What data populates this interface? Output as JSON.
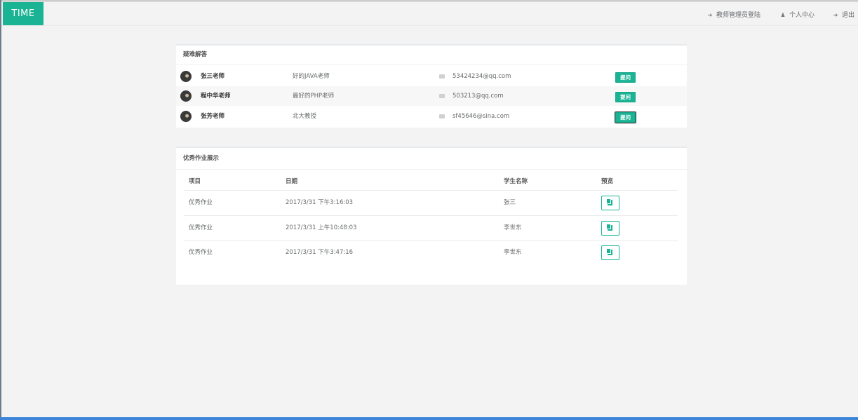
{
  "brand": "TIME",
  "nav": {
    "teacher_admin_login": "教师管理员登陆",
    "personal_center": "个人中心",
    "logout": "退出"
  },
  "qa": {
    "title": "疑难解答",
    "rows": [
      {
        "name": "张三老师",
        "desc": "好的JAVA老师",
        "email": "53424234@qq.com",
        "button": "提问"
      },
      {
        "name": "程中华老师",
        "desc": "最好的PHP老师",
        "email": "503213@qq.com",
        "button": "提问"
      },
      {
        "name": "张芳老师",
        "desc": "北大教授",
        "email": "sf45646@sina.com",
        "button": "提问"
      }
    ]
  },
  "homework": {
    "title": "优秀作业展示",
    "headers": [
      "项目",
      "日期",
      "学生名称",
      "预览"
    ],
    "rows": [
      {
        "project": "优秀作业",
        "date": "2017/3/31 下午3:16:03",
        "student": "张三"
      },
      {
        "project": "优秀作业",
        "date": "2017/3/31 上午10:48:03",
        "student": "李世东"
      },
      {
        "project": "优秀作业",
        "date": "2017/3/31 下午3:47:16",
        "student": "李世东"
      }
    ]
  },
  "colors": {
    "accent": "#1ab394",
    "background": "#f3f3f4"
  },
  "icons": {
    "login": "sign-in-icon",
    "user": "user-icon",
    "logout": "sign-out-icon",
    "email": "envelope-icon",
    "preview": "copy-icon"
  }
}
